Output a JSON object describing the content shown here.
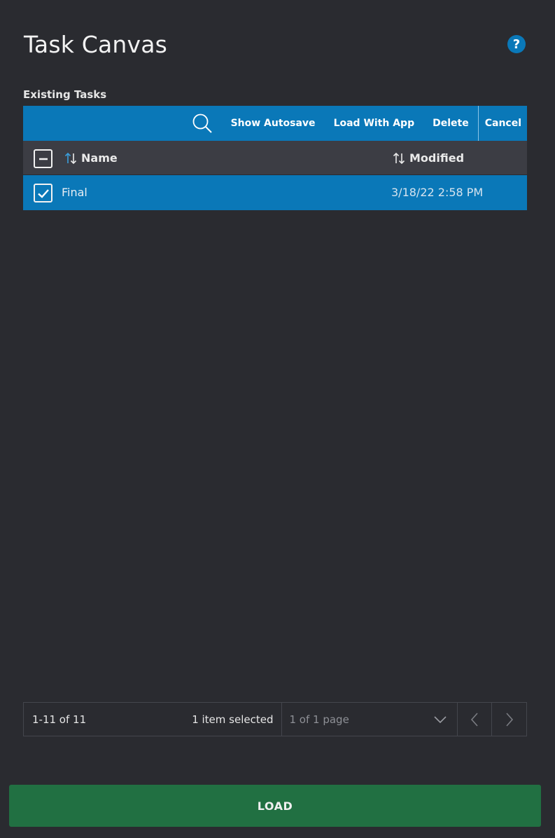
{
  "page": {
    "title": "Task Canvas",
    "help_symbol": "?"
  },
  "section": {
    "label": "Existing Tasks"
  },
  "toolbar": {
    "show_autosave": "Show Autosave",
    "load_with_app": "Load With App",
    "delete": "Delete",
    "cancel": "Cancel"
  },
  "table": {
    "columns": [
      {
        "label": "Name"
      },
      {
        "label": "Modified"
      }
    ],
    "rows": [
      {
        "name": "Final",
        "modified": "3/18/22 2:58 PM",
        "selected": true
      }
    ]
  },
  "pager": {
    "range": "1-11 of 11",
    "selection": "1 item selected",
    "page": "1 of 1 page"
  },
  "footer": {
    "load_label": "LOAD"
  },
  "colors": {
    "accent": "#0a78b8",
    "background": "#2a2b30",
    "header_row": "#3c3d44",
    "load_button": "#217042"
  },
  "icons": {
    "help": "help-icon",
    "search": "search-icon",
    "sort": "sort-icon",
    "checkbox_partial": "checkbox-indeterminate-icon",
    "checkbox_checked": "checkbox-checked-icon",
    "dropdown": "chevron-down-icon",
    "prev": "chevron-left-icon",
    "next": "chevron-right-icon"
  }
}
